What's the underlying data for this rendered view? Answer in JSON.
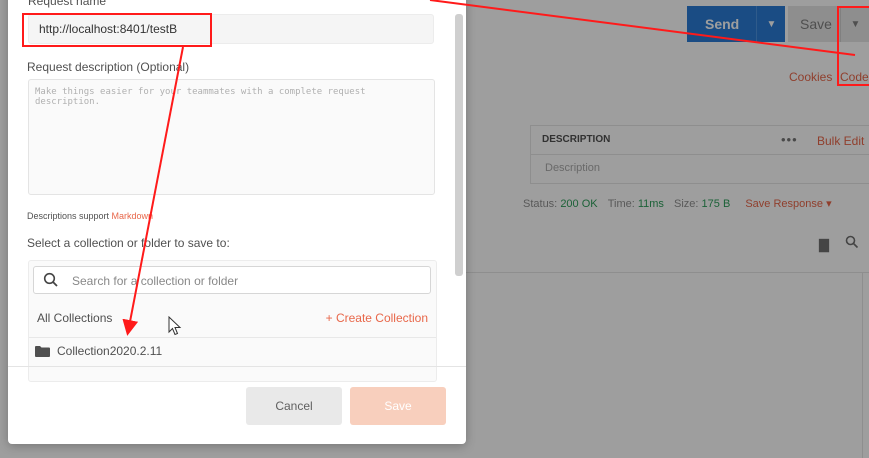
{
  "app": {
    "send_label": "Send",
    "save_label": "Save",
    "cookies_label": "Cookies",
    "code_label": "Code",
    "kv_header": "DESCRIPTION",
    "kv_dots": "•••",
    "bulk_edit_label": "Bulk Edit",
    "kv_placeholder": "Description",
    "status": {
      "status_label": "Status:",
      "status_value": "200 OK",
      "time_label": "Time:",
      "time_value": "11ms",
      "size_label": "Size:",
      "size_value": "175 B",
      "save_response_label": "Save Response"
    }
  },
  "modal": {
    "request_name_label": "Request name",
    "request_name_value": "http://localhost:8401/testB",
    "description_label": "Request description (Optional)",
    "description_placeholder": "Make things easier for your teammates with a complete request description.",
    "markdown_note_prefix": "Descriptions support ",
    "markdown_link": "Markdown",
    "collection_prompt": "Select a collection or folder to save to:",
    "search_placeholder": "Search for a collection or folder",
    "all_collections_label": "All Collections",
    "create_collection_label": "+ Create Collection",
    "collections": [
      {
        "name": "Collection2020.2.11",
        "icon": "folder-icon"
      }
    ],
    "cancel_label": "Cancel",
    "save_label": "Save"
  },
  "colors": {
    "accent": "#e8674a",
    "send_blue": "#2a7bd6",
    "annotation_red": "#ff1a1a",
    "status_green": "#2e9e5b"
  }
}
